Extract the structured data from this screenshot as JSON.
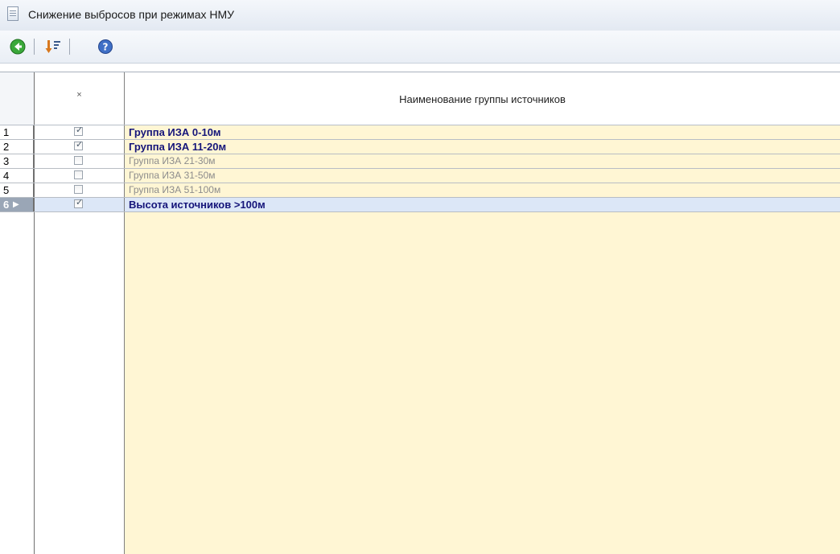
{
  "window": {
    "title": "Снижение выбросов при режимах НМУ"
  },
  "toolbar": {
    "buttons": [
      {
        "icon": "back-arrow-icon"
      },
      {
        "icon": "sort-icon"
      },
      {
        "icon": "help-icon"
      }
    ]
  },
  "grid": {
    "columns": {
      "rownum": "",
      "check": "×",
      "name": "Наименование группы источников"
    },
    "rows": [
      {
        "num": "1",
        "checked": true,
        "name": "Группа ИЗА 0-10м",
        "active": true
      },
      {
        "num": "2",
        "checked": true,
        "name": "Группа ИЗА 11-20м",
        "active": true
      },
      {
        "num": "3",
        "checked": false,
        "name": "Группа ИЗА 21-30м",
        "active": false
      },
      {
        "num": "4",
        "checked": false,
        "name": "Группа ИЗА 31-50м",
        "active": false
      },
      {
        "num": "5",
        "checked": false,
        "name": "Группа ИЗА 51-100м",
        "active": false
      },
      {
        "num": "6",
        "checked": true,
        "name": "Высота источников >100м",
        "active": true,
        "selected": true
      }
    ]
  }
}
